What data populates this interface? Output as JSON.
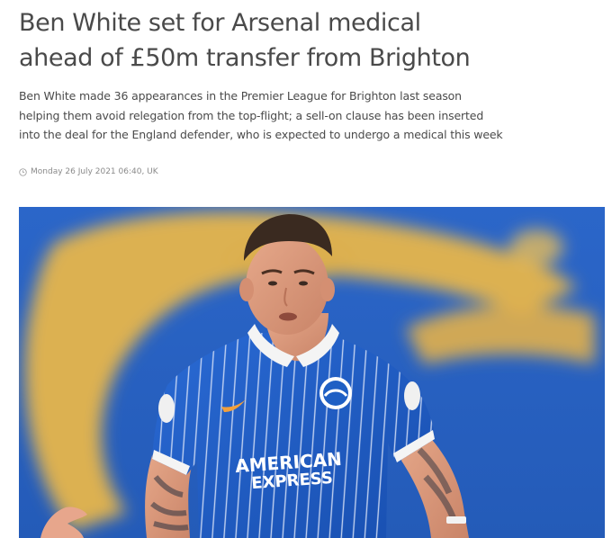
{
  "article": {
    "headline_line1": "Ben White set for Arsenal medical",
    "headline_line2": "ahead of £50m transfer from Brighton",
    "standfirst_line1": "Ben White made 36 appearances in the Premier League for Brighton last season",
    "standfirst_line2": "helping them avoid relegation from the top-flight; a sell-on clause has been inserted",
    "standfirst_line3": "into the deal for the England defender, who is expected to undergo a medical this week",
    "published": "Monday 26 July 2021 06:40, UK"
  },
  "hero_image": {
    "shirt_sponsor_line1": "AMERICAN",
    "shirt_sponsor_line2": "EXPRESS"
  },
  "colors": {
    "text": "#4a4a4a",
    "muted": "#8a8a8a",
    "brighton_blue": "#1f5fc4",
    "stadium_blue": "#2f63b8",
    "stand_yellow": "#e9b84a"
  },
  "icons": {
    "clock": "clock-icon"
  }
}
